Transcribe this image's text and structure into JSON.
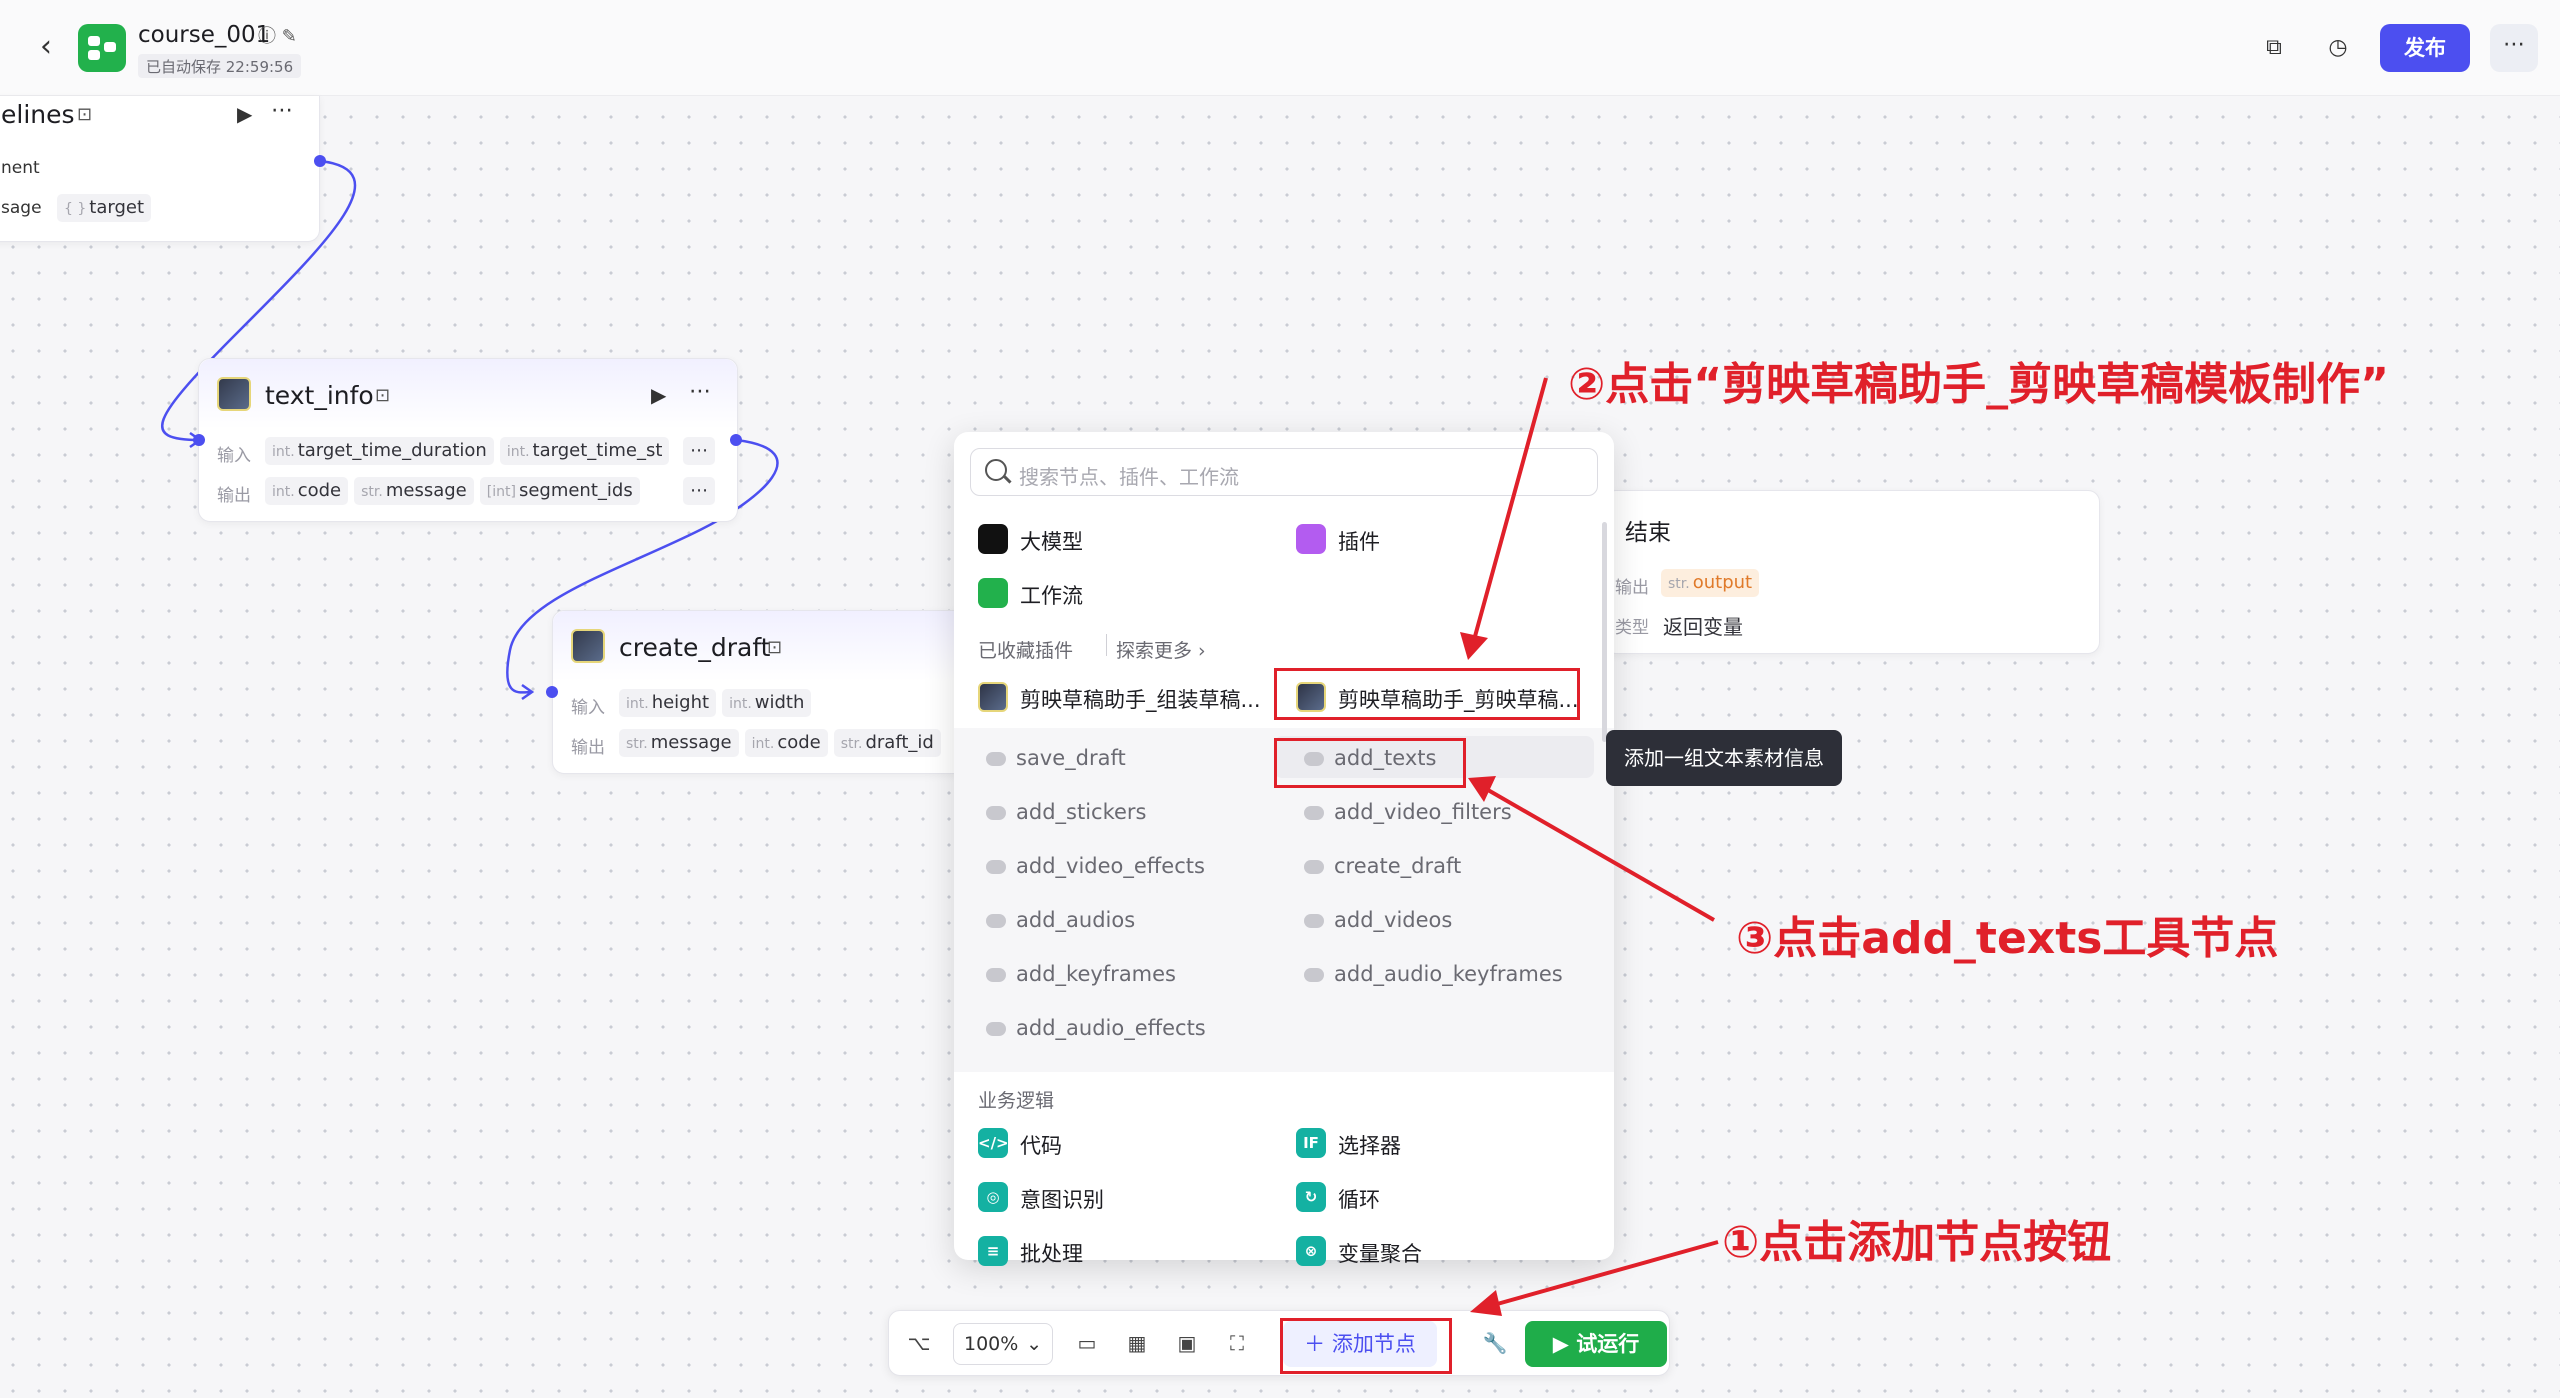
{
  "header": {
    "title": "course_001",
    "autosave": "已自动保存 22:59:56",
    "publish_label": "发布"
  },
  "nodes": {
    "pipelines": {
      "title_fragment": "elines",
      "input_fragment": "nent",
      "output_fragment": "sage",
      "output_tag_type": "{ }",
      "output_tag_name": "target"
    },
    "text_info": {
      "title": "text_info",
      "input_label": "输入",
      "output_label": "输出",
      "inputs": [
        {
          "type": "int.",
          "name": "target_time_duration"
        },
        {
          "type": "int.",
          "name": "target_time_st"
        }
      ],
      "outputs": [
        {
          "type": "int.",
          "name": "code"
        },
        {
          "type": "str.",
          "name": "message"
        },
        {
          "type": "[int]",
          "name": "segment_ids"
        }
      ]
    },
    "create_draft": {
      "title": "create_draft",
      "input_label": "输入",
      "output_label": "输出",
      "inputs": [
        {
          "type": "int.",
          "name": "height"
        },
        {
          "type": "int.",
          "name": "width"
        }
      ],
      "outputs": [
        {
          "type": "str.",
          "name": "message"
        },
        {
          "type": "int.",
          "name": "code"
        },
        {
          "type": "str.",
          "name": "draft_id"
        }
      ]
    },
    "end": {
      "title": "结束",
      "output_label": "输出",
      "output_type": "str.",
      "output_name": "output",
      "type_label": "类型",
      "type_value": "返回变量"
    }
  },
  "popup": {
    "search_placeholder": "搜索节点、插件、工作流",
    "categories": [
      "大模型",
      "插件",
      "工作流"
    ],
    "favorites_label": "已收藏插件",
    "explore_more": "探索更多",
    "plugins": [
      "剪映草稿助手_组装草稿...",
      "剪映草稿助手_剪映草稿..."
    ],
    "tools_left": [
      "save_draft",
      "add_stickers",
      "add_video_effects",
      "add_audios",
      "add_keyframes",
      "add_audio_effects"
    ],
    "tools_right": [
      "add_texts",
      "add_video_filters",
      "create_draft",
      "add_videos",
      "add_audio_keyframes"
    ],
    "business_label": "业务逻辑",
    "business_left": [
      "代码",
      "意图识别",
      "批处理"
    ],
    "business_right": [
      "选择器",
      "循环",
      "变量聚合"
    ],
    "tooltip": "添加一组文本素材信息"
  },
  "toolbar": {
    "zoom": "100%",
    "add_node": "添加节点",
    "run": "试运行"
  },
  "annotations": {
    "step1": "①点击添加节点按钮",
    "step2": "②点击“剪映草稿助手_剪映草稿模板制作”",
    "step3": "③点击add_texts工具节点"
  },
  "colors": {
    "accent": "#4c4ff0",
    "run_green": "#1fad4a",
    "annotation_red": "#e0202a"
  }
}
